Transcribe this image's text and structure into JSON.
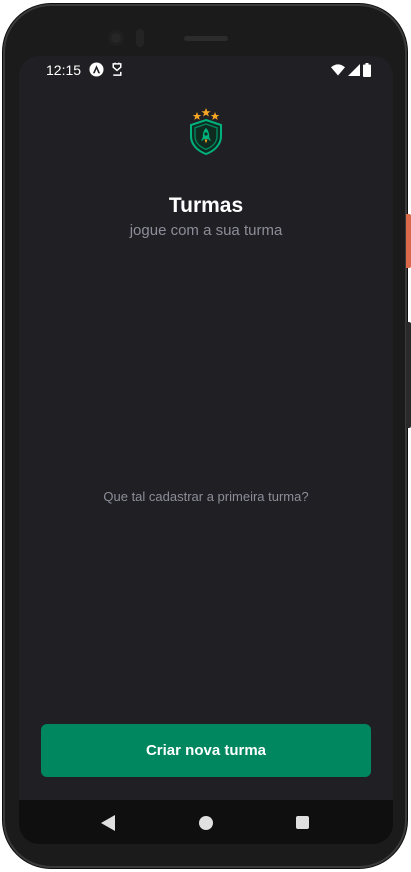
{
  "status_bar": {
    "time": "12:15",
    "icons": [
      "app-a-icon",
      "notification-icon",
      "wifi-icon",
      "signal-icon",
      "battery-icon"
    ]
  },
  "header": {
    "logo": "team-shield-logo",
    "title": "Turmas",
    "subtitle": "jogue com a sua turma"
  },
  "list": {
    "empty_message": "Que tal cadastrar a primeira turma?"
  },
  "footer": {
    "create_button_label": "Criar nova turma"
  },
  "nav_bar": {
    "icons": [
      "back-icon",
      "home-icon",
      "recent-apps-icon"
    ]
  },
  "colors": {
    "background": "#202024",
    "primary_button": "#00875f",
    "title_text": "#ffffff",
    "muted_text": "#8d8d99",
    "logo_stars": "#f5a524",
    "logo_green": "#00b37e"
  }
}
